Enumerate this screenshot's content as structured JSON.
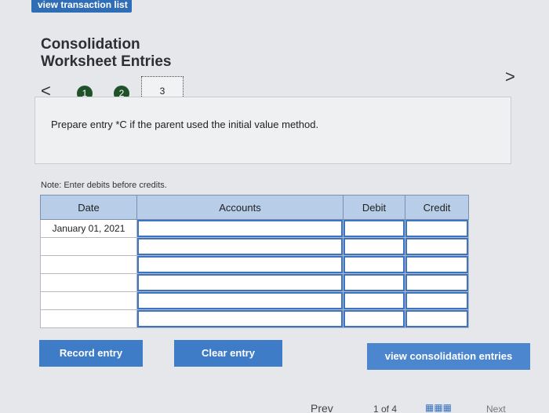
{
  "topbar": {
    "label": "view transaction list"
  },
  "page": {
    "title_line1": "Consolidation",
    "title_line2": "Worksheet Entries"
  },
  "stepper": {
    "prev_symbol": "<",
    "next_symbol": ">",
    "steps": [
      {
        "label": "1",
        "state": "done"
      },
      {
        "label": "2",
        "state": "done"
      },
      {
        "label": "3",
        "state": "current"
      }
    ]
  },
  "prompt": {
    "text": "Prepare entry *C if the parent used the initial value method."
  },
  "note": {
    "text": "Note: Enter debits before credits."
  },
  "table": {
    "headers": {
      "date": "Date",
      "accounts": "Accounts",
      "debit": "Debit",
      "credit": "Credit"
    },
    "rows": [
      {
        "date": "January 01, 2021",
        "account": "",
        "debit": "",
        "credit": ""
      },
      {
        "date": "",
        "account": "",
        "debit": "",
        "credit": ""
      },
      {
        "date": "",
        "account": "",
        "debit": "",
        "credit": ""
      },
      {
        "date": "",
        "account": "",
        "debit": "",
        "credit": ""
      },
      {
        "date": "",
        "account": "",
        "debit": "",
        "credit": ""
      },
      {
        "date": "",
        "account": "",
        "debit": "",
        "credit": ""
      }
    ]
  },
  "buttons": {
    "record": "Record entry",
    "clear": "Clear entry",
    "view": "view consolidation entries"
  },
  "footer": {
    "prev": "Prev",
    "count": "1 of 4",
    "grid_icon": "grid-icon",
    "next": "Next"
  },
  "colors": {
    "accent": "#3f7cc8",
    "header_bg": "#b8cde8",
    "step_done": "#1f5229"
  }
}
